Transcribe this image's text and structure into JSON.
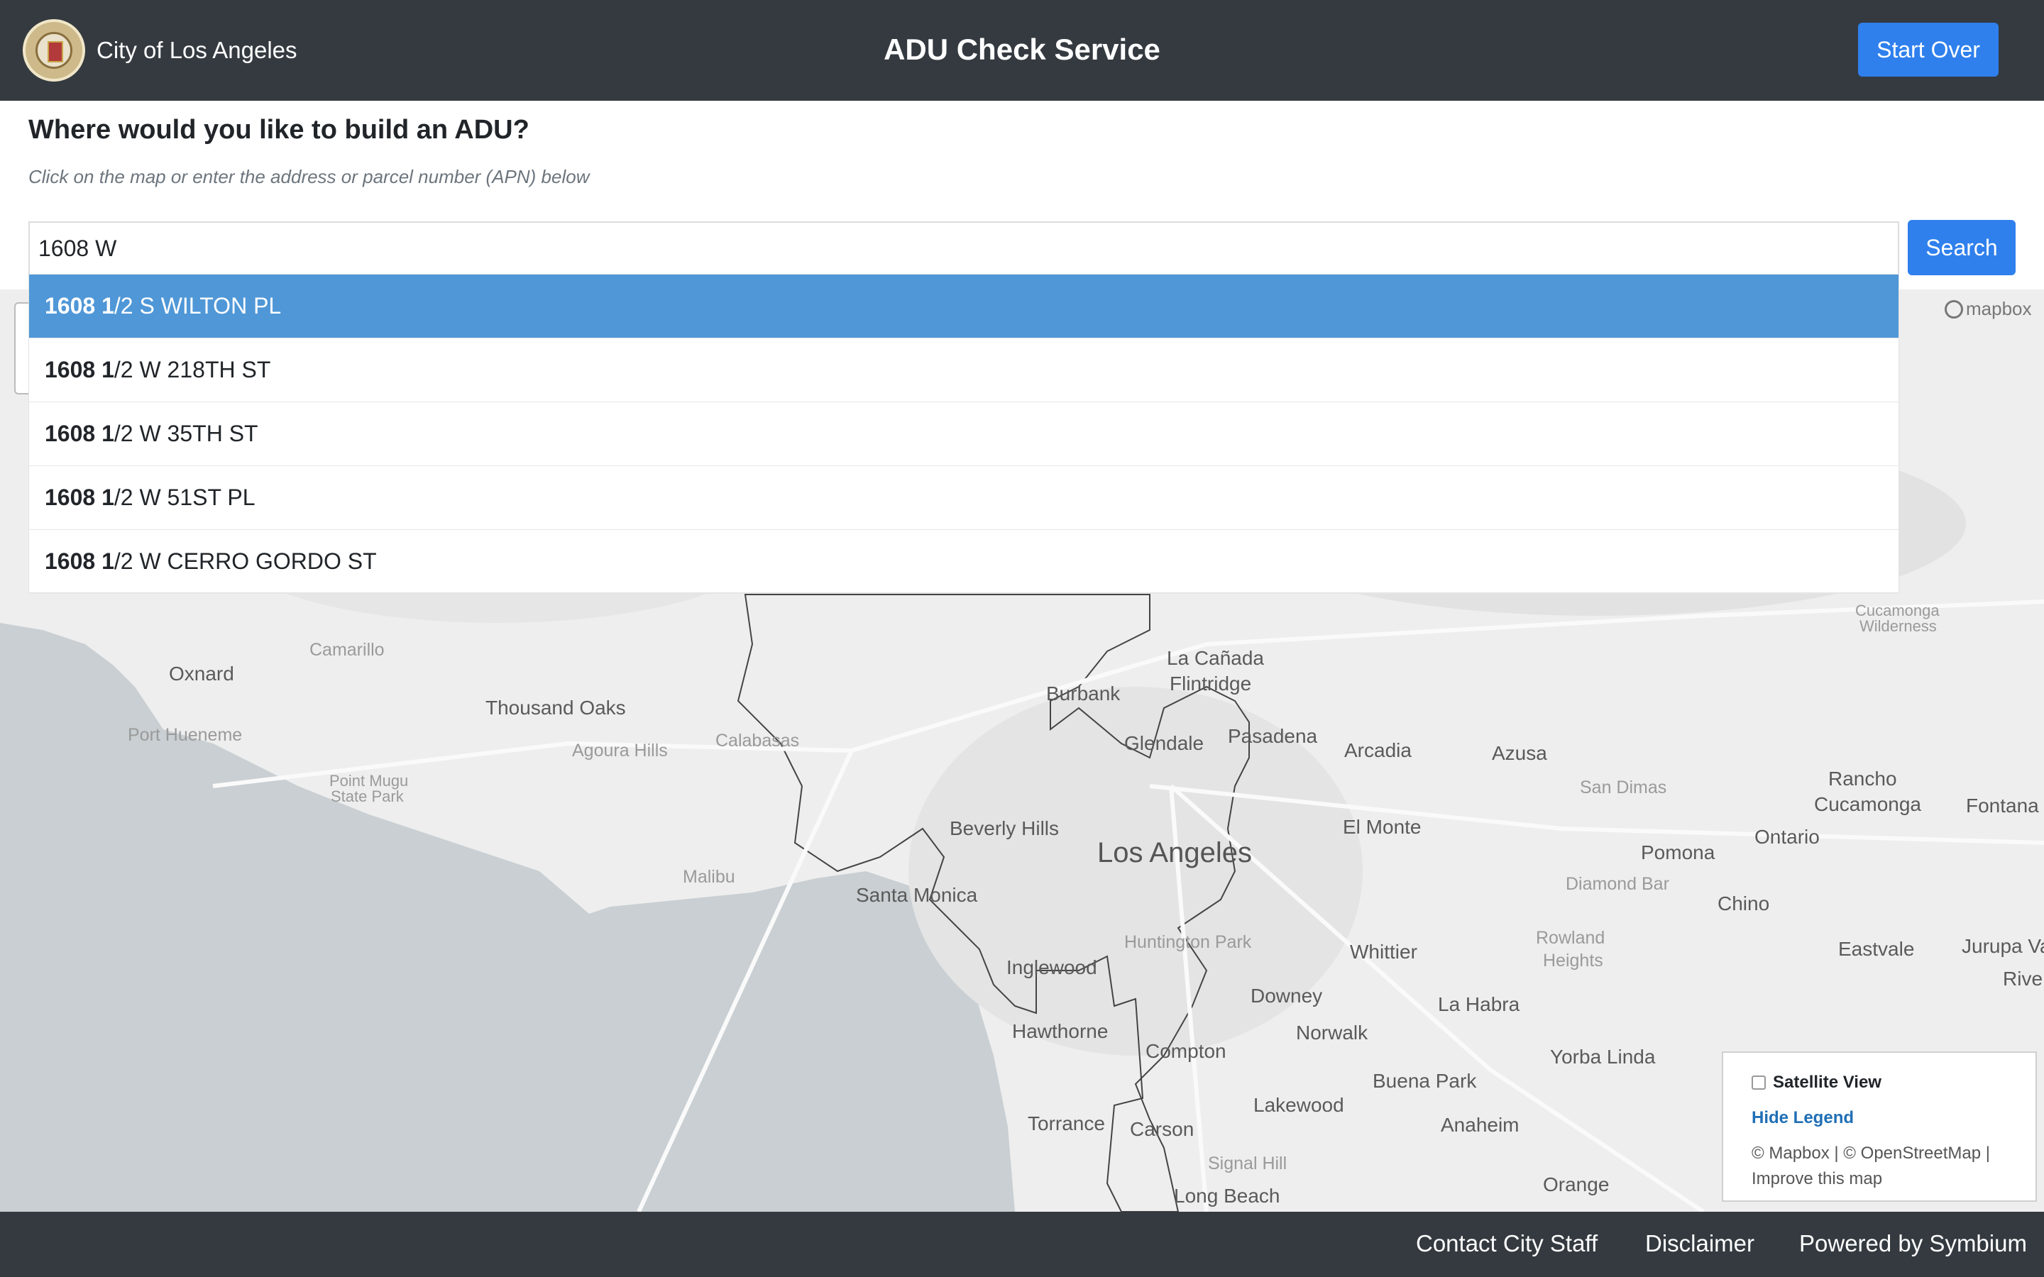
{
  "header": {
    "brand": "City of Los Angeles",
    "title": "ADU Check Service",
    "start_over": "Start Over"
  },
  "prompt": {
    "heading": "Where would you like to build an ADU?",
    "subheading": "Click on the map or enter the address or parcel number (APN) below",
    "input_value": "1608 W",
    "search_label": "Search"
  },
  "suggestions": [
    {
      "match": "1608 1",
      "rest": "/2 S WILTON PL"
    },
    {
      "match": "1608 1",
      "rest": "/2 W 218TH ST"
    },
    {
      "match": "1608 1",
      "rest": "/2 W 35TH ST"
    },
    {
      "match": "1608 1",
      "rest": "/2 W 51ST PL"
    },
    {
      "match": "1608 1",
      "rest": "/2 W CERRO GORDO ST"
    }
  ],
  "map": {
    "attribution_logo": "mapbox",
    "places": {
      "camarillo": "Camarillo",
      "oxnard": "Oxnard",
      "thousand_oaks": "Thousand Oaks",
      "port_hueneme": "Port Hueneme",
      "agoura_hills": "Agoura Hills",
      "calabasas": "Calabasas",
      "point_mugu": "Point Mugu",
      "point_mugu_2": "State Park",
      "malibu": "Malibu",
      "burbank": "Burbank",
      "la_canada": "La Cañada",
      "flintridge": "Flintridge",
      "glendale": "Glendale",
      "pasadena": "Pasadena",
      "arcadia": "Arcadia",
      "azusa": "Azusa",
      "cucamonga_wilderness": "Cucamonga",
      "cucamonga_wilderness_2": "Wilderness",
      "rancho_cucamonga": "Rancho",
      "rancho_cucamonga_2": "Cucamonga",
      "fontana": "Fontana",
      "san_dimas": "San Dimas",
      "beverly_hills": "Beverly Hills",
      "los_angeles": "Los Angeles",
      "el_monte": "El Monte",
      "ontario": "Ontario",
      "pomona": "Pomona",
      "santa_monica": "Santa Monica",
      "diamond_bar": "Diamond Bar",
      "chino": "Chino",
      "huntington_park": "Huntington Park",
      "eastvale": "Eastvale",
      "jurupa_valley": "Jurupa Valle",
      "riverside": "Rive",
      "whittier": "Whittier",
      "rowland_heights": "Rowland",
      "rowland_heights_2": "Heights",
      "inglewood": "Inglewood",
      "downey": "Downey",
      "la_habra": "La Habra",
      "hawthorne": "Hawthorne",
      "norwalk": "Norwalk",
      "compton": "Compton",
      "yorba_linda": "Yorba Linda",
      "buena_park": "Buena Park",
      "lakewood": "Lakewood",
      "anaheim": "Anaheim",
      "torrance": "Torrance",
      "carson": "Carson",
      "signal_hill": "Signal Hill",
      "long_beach": "Long Beach",
      "orange": "Orange"
    }
  },
  "legend": {
    "satellite": "Satellite View",
    "hide": "Hide Legend",
    "attribution_line1": "© Mapbox | © OpenStreetMap |",
    "attribution_line2": "Improve this map"
  },
  "footer": {
    "contact": "Contact City Staff",
    "disclaimer": "Disclaimer",
    "powered": "Powered by Symbium"
  }
}
